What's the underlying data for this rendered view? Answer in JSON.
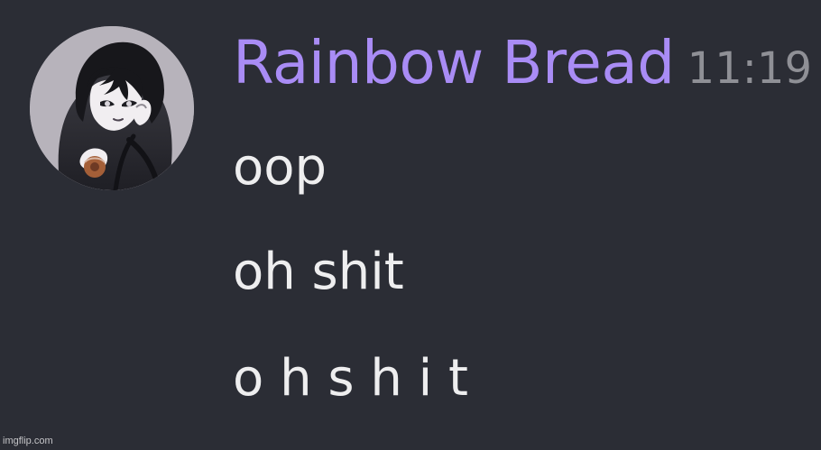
{
  "message": {
    "author": "Rainbow Bread",
    "timestamp": "11:19",
    "lines": [
      "oop",
      "oh shit",
      "o h s h i t"
    ]
  },
  "avatar": {
    "icon": "anime-character-avatar",
    "colors": {
      "background": "#b7b3bb",
      "hoodie": "#2a2a30",
      "hair": "#17171b",
      "skin": "#f1eef1",
      "donut": "#a45f38"
    }
  },
  "theme": {
    "background": "#2b2d35",
    "username": "#a98cf5",
    "timestamp": "#8f9096",
    "text": "#eeeeef"
  },
  "watermark": "imgflip.com"
}
